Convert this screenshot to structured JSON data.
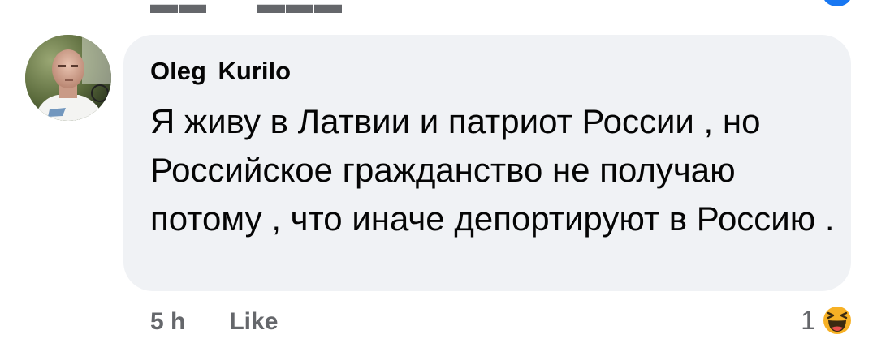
{
  "comment": {
    "author": "Oleg Kurilo",
    "text": "Я живу в Латвии и патриот России , но Российское гражданство не получаю потому , что иначе депортируют в Россию .",
    "timestamp": "5 h",
    "like_label": "Like",
    "reaction_count": "1",
    "reaction_icon": "haha-emoji-icon"
  },
  "colors": {
    "bubble_bg": "#f0f2f5",
    "meta_text": "#65676b",
    "text": "#050505",
    "reaction_yellow": "#f7b125"
  }
}
